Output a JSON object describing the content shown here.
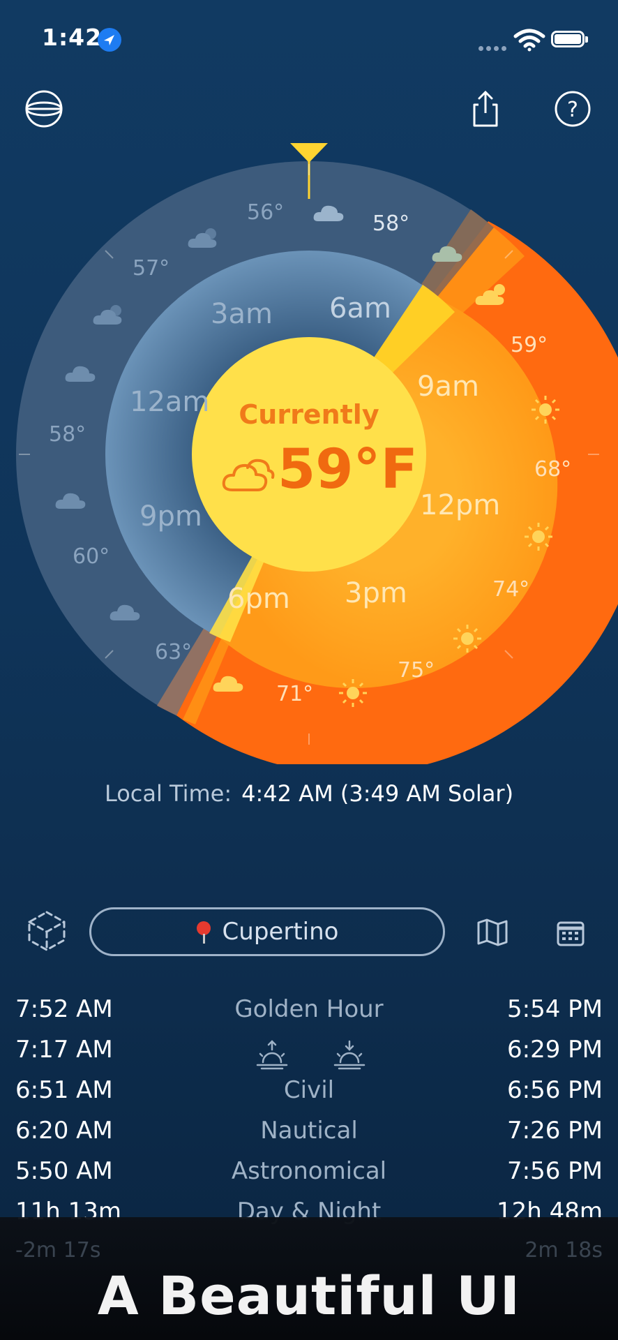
{
  "status_bar": {
    "time": "1:42"
  },
  "dial": {
    "outer_labels": [
      "56°",
      "58°",
      "57°",
      "59°",
      "58°",
      "68°",
      "60°",
      "74°",
      "63°",
      "75°",
      "71°"
    ],
    "hour_labels": [
      "3am",
      "6am",
      "12am",
      "9am",
      "12pm",
      "9pm",
      "6pm",
      "3pm"
    ]
  },
  "current": {
    "label": "Currently",
    "temperature": "59°F"
  },
  "local_time": {
    "label": "Local Time:",
    "value": "4:42 AM  (3:49 AM Solar)"
  },
  "location": {
    "name": "Cupertino"
  },
  "sun_times": [
    {
      "morning": "7:52 AM",
      "label": "Golden Hour",
      "evening": "5:54 PM"
    },
    {
      "morning": "7:17 AM",
      "label": "",
      "evening": "6:29 PM"
    },
    {
      "morning": "6:51 AM",
      "label": "Civil",
      "evening": "6:56 PM"
    },
    {
      "morning": "6:20 AM",
      "label": "Nautical",
      "evening": "7:26 PM"
    },
    {
      "morning": "5:50 AM",
      "label": "Astronomical",
      "evening": "7:56 PM"
    },
    {
      "morning": "11h 13m",
      "label": "Day & Night",
      "evening": "12h 48m"
    }
  ],
  "ghost_row": {
    "left": "-2m 17s",
    "right": "2m 18s"
  },
  "banner": {
    "title": "A Beautiful UI"
  },
  "colors": {
    "night_blue": "#4a6f93",
    "day_orange": "#ff6a0c",
    "sun_yellow": "#ffe04a",
    "accent_blue": "#1e7cf2"
  }
}
